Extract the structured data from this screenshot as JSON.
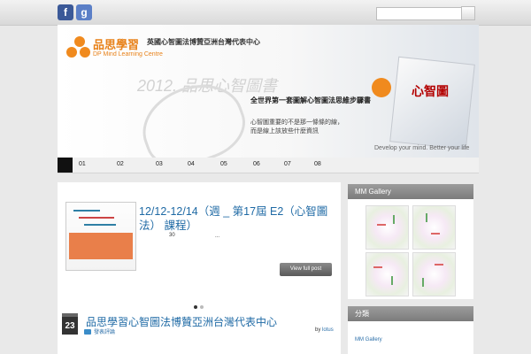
{
  "topbar": {
    "facebook_glyph": "f",
    "google_glyph": "g",
    "search_placeholder": ""
  },
  "banner": {
    "brand_cn": "品思學習",
    "brand_en": "DP Mind Learning Centre",
    "tagline": "英國心智圖法博贊亞洲台灣代表中心",
    "watermark": "2012. 品思心智圖書",
    "slogan_main": "全世界第一套圖解心智圖法思維步驟書",
    "slogan_line1": "心智圖重要的不是那一條條的線，",
    "slogan_line2": "而是線上該放些什麼資訊",
    "book_title": "心智圖",
    "footer": "Develop your mind. Better your life"
  },
  "nav": {
    "items": [
      "01",
      "02",
      "03",
      "04",
      "05",
      "06",
      "07",
      "08"
    ]
  },
  "featured": {
    "title": "12/12-12/14（週 _ 第17屆 E2（心智圖法） 課程）",
    "meta_number": "30",
    "meta_ellipsis": "...",
    "view_button": "View full post"
  },
  "post2": {
    "date_day": "23",
    "title": "品思學習心智圖法博贊亞洲台灣代表中心",
    "comments": "發表評論",
    "by_label": "by",
    "author": "lotus"
  },
  "sidebar": {
    "gallery_heading": "MM Gallery",
    "second_heading": "分類",
    "links": [
      "MM Gallery"
    ]
  },
  "colors": {
    "accent_orange": "#f08a1e",
    "link_blue": "#1f6aa5",
    "facebook": "#3b5998"
  }
}
